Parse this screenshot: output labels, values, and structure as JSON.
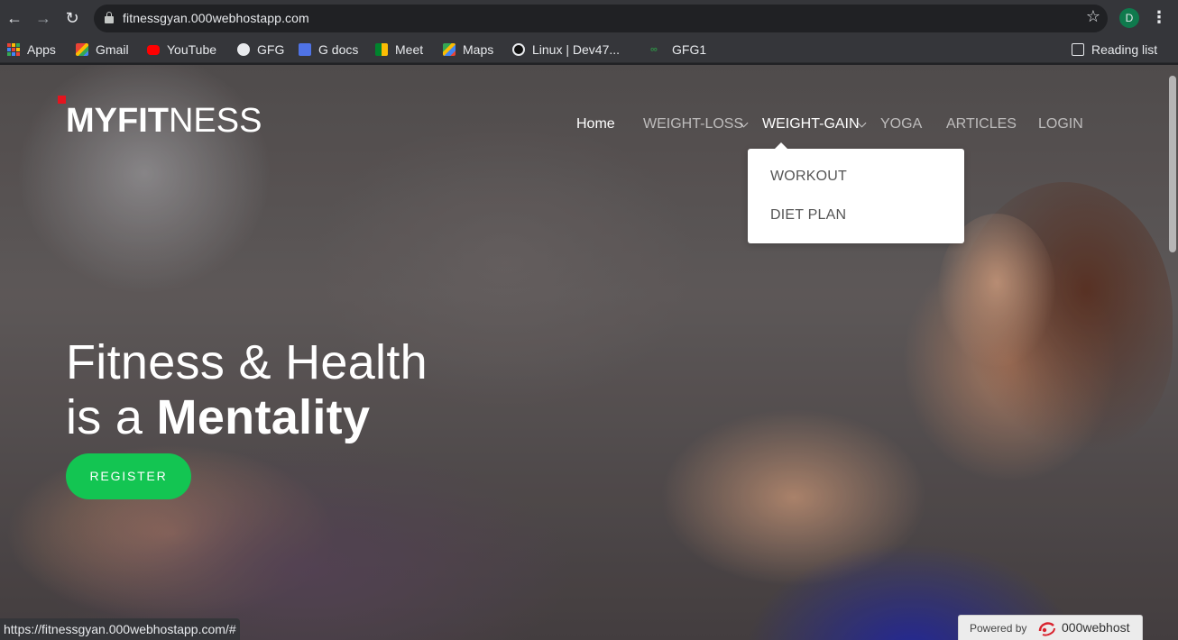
{
  "browser": {
    "url": "fitnessgyan.000webhostapp.com",
    "profile_initial": "D",
    "bookmarks": [
      {
        "label": "Apps",
        "icon": "apps-grid-icon"
      },
      {
        "label": "Gmail",
        "icon": "gmail-icon"
      },
      {
        "label": "YouTube",
        "icon": "youtube-icon"
      },
      {
        "label": "GFG",
        "icon": "globe-icon"
      },
      {
        "label": "G docs",
        "icon": "docs-icon"
      },
      {
        "label": "Meet",
        "icon": "meet-icon"
      },
      {
        "label": "Maps",
        "icon": "maps-icon"
      },
      {
        "label": "Linux | Dev47...",
        "icon": "linux-icon"
      },
      {
        "label": "GFG1",
        "icon": "gfg-icon"
      }
    ],
    "reading_list": "Reading list",
    "status_url": "https://fitnessgyan.000webhostapp.com/#"
  },
  "site": {
    "logo_bold": "MYFIT",
    "logo_thin": "NESS",
    "nav": [
      {
        "label": "Home"
      },
      {
        "label": "WEIGHT-LOSS"
      },
      {
        "label": "WEIGHT-GAIN"
      },
      {
        "label": "YOGA"
      },
      {
        "label": "ARTICLES"
      },
      {
        "label": "LOGIN"
      }
    ],
    "dropdown": [
      "WORKOUT",
      "DIET PLAN"
    ],
    "hero_line1": "Fitness & Health",
    "hero_line2_prefix": "is a ",
    "hero_line2_bold": "Mentality",
    "register_label": "REGISTER",
    "powered_by": "Powered by",
    "host_brand": "000webhost"
  },
  "colors": {
    "accent_green": "#13c552",
    "logo_red": "#e4141e",
    "chrome_bg": "#35363a"
  }
}
